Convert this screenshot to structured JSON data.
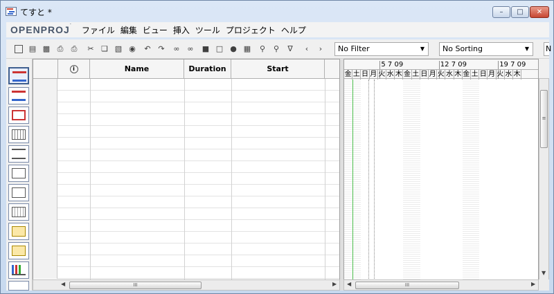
{
  "window": {
    "title": "てすと *"
  },
  "brand": {
    "name": "OPENPROJ",
    "mark": "´"
  },
  "menu": [
    "ファイル",
    "編集",
    "ビュー",
    "挿入",
    "ツール",
    "プロジェクト",
    "ヘルプ"
  ],
  "toolbar": {
    "filter": "No Filter",
    "sorting": "No Sorting",
    "overflow": "N"
  },
  "table": {
    "columns": [
      "",
      "",
      "Name",
      "Duration",
      "Start",
      ""
    ]
  },
  "gantt": {
    "weeks": [
      "5 7 09",
      "12 7 09",
      "19 7 09"
    ],
    "days": [
      "金",
      "土",
      "日",
      "月",
      "火",
      "水",
      "木",
      "金",
      "土",
      "日",
      "月",
      "火",
      "水",
      "木",
      "金",
      "土",
      "日",
      "月",
      "火",
      "水",
      "木"
    ]
  },
  "scroll": {
    "grip": "III"
  }
}
